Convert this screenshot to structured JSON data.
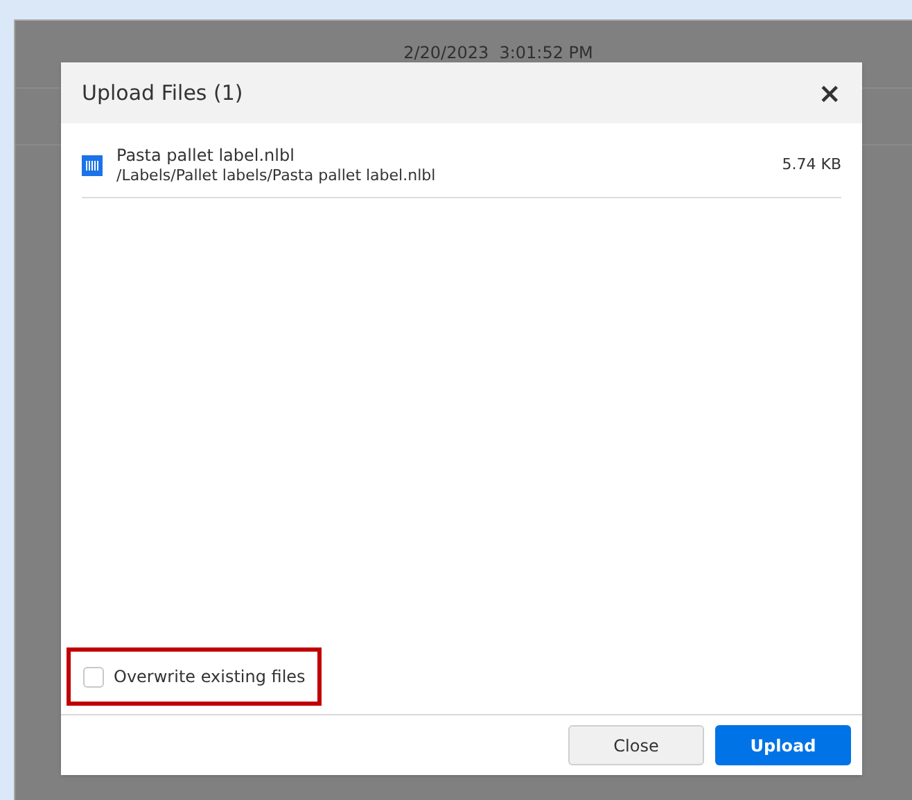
{
  "background": {
    "timestamp": "2/20/2023  3:01:52 PM"
  },
  "dialog": {
    "title": "Upload Files (1)",
    "close_glyph": "×",
    "files": [
      {
        "name": "Pasta pallet label.nlbl",
        "path": "/Labels/Pallet labels/Pasta pallet label.nlbl",
        "size": "5.74 KB"
      }
    ],
    "overwrite": {
      "label": "Overwrite existing files",
      "checked": false,
      "highlighted": true
    },
    "buttons": [
      {
        "label": "Close",
        "kind": "secondary"
      },
      {
        "label": "Upload",
        "kind": "primary"
      }
    ]
  }
}
